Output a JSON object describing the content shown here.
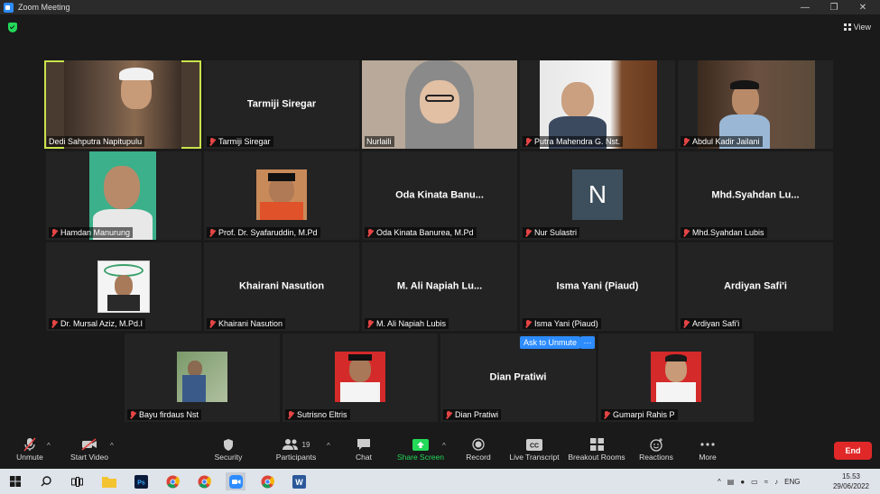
{
  "window": {
    "title": "Zoom Meeting"
  },
  "header": {
    "view_label": "View"
  },
  "tiles": [
    {
      "name": "Dedi Sahputra Napitupulu",
      "big": "",
      "muted": false
    },
    {
      "name": "Tarmiji Siregar",
      "big": "Tarmiji Siregar",
      "muted": true
    },
    {
      "name": "Nurlaili",
      "big": "",
      "muted": false
    },
    {
      "name": "Putra Mahendra G. Nst.",
      "big": "",
      "muted": true
    },
    {
      "name": "Abdul Kadir Jailani",
      "big": "",
      "muted": true
    },
    {
      "name": "Hamdan Manurung",
      "big": "",
      "muted": true
    },
    {
      "name": "Prof. Dr. Syafaruddin, M.Pd",
      "big": "",
      "muted": true
    },
    {
      "name": "Oda Kinata Banurea, M.Pd",
      "big": "Oda Kinata Banu...",
      "muted": true
    },
    {
      "name": "Nur Sulastri",
      "big": "",
      "muted": true,
      "initial": "N"
    },
    {
      "name": "Mhd.Syahdan Lubis",
      "big": "Mhd.Syahdan Lu...",
      "muted": true
    },
    {
      "name": "Dr. Mursal Aziz, M.Pd.I",
      "big": "",
      "muted": true
    },
    {
      "name": "Khairani Nasution",
      "big": "Khairani Nasution",
      "muted": true
    },
    {
      "name": "M. Ali Napiah Lubis",
      "big": "M. Ali Napiah Lu...",
      "muted": true
    },
    {
      "name": "Isma Yani (Piaud)",
      "big": "Isma Yani (Piaud)",
      "muted": true
    },
    {
      "name": "Ardiyan Safi'i",
      "big": "Ardiyan Safi'i",
      "muted": true
    },
    {
      "name": "Bayu firdaus Nst",
      "big": "",
      "muted": true
    },
    {
      "name": "Sutrisno Eltris",
      "big": "",
      "muted": true
    },
    {
      "name": "Dian Pratiwi",
      "big": "Dian Pratiwi",
      "muted": true
    },
    {
      "name": "Gumarpi Rahis P",
      "big": "",
      "muted": true
    }
  ],
  "ask_to_unmute": "Ask to Unmute",
  "more_dots": "···",
  "toolbar": {
    "unmute": "Unmute",
    "start_video": "Start Video",
    "security": "Security",
    "participants": "Participants",
    "participants_count": "19",
    "chat": "Chat",
    "share_screen": "Share Screen",
    "record": "Record",
    "live_transcript": "Live Transcript",
    "breakout_rooms": "Breakout Rooms",
    "reactions": "Reactions",
    "more": "More",
    "end": "End"
  },
  "taskbar": {
    "language": "ENG",
    "time": "15.53",
    "date": "29/06/2022"
  },
  "colors": {
    "accent": "#2d8cff",
    "active_speaker": "#c9e34b",
    "end": "#e02828",
    "share": "#23d959"
  }
}
